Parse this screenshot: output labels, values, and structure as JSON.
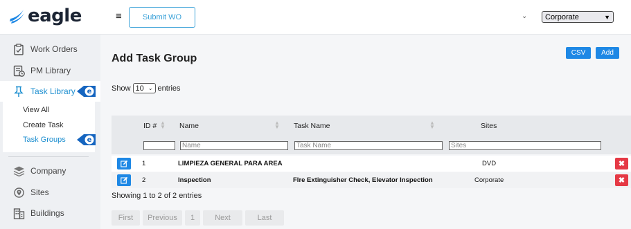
{
  "header": {
    "logo_text": "eagle",
    "menu_icon": "hamburger-icon",
    "submit_wo_label": "Submit WO",
    "site_selector_value": "Corporate",
    "brand_color": "#1e88e5"
  },
  "sidebar": {
    "items": [
      {
        "label": "Work Orders",
        "icon": "clipboard-check-icon"
      },
      {
        "label": "PM Library",
        "icon": "document-clock-icon"
      },
      {
        "label": "Task Library",
        "icon": "pin-icon",
        "active": true
      },
      {
        "label": "Company",
        "icon": "layers-icon"
      },
      {
        "label": "Sites",
        "icon": "location-target-icon"
      },
      {
        "label": "Buildings",
        "icon": "building-icon"
      }
    ],
    "subitems": [
      {
        "label": "View All"
      },
      {
        "label": "Create Task"
      },
      {
        "label": "Task Groups",
        "active": true
      }
    ]
  },
  "main": {
    "title": "Add Task Group",
    "csv_label": "CSV",
    "add_label": "Add",
    "show_label": "Show",
    "entries_label": "entries",
    "page_length": "10",
    "columns": [
      "ID #",
      "Name",
      "Task Name",
      "Sites"
    ],
    "filters": {
      "id": "",
      "name": "Name",
      "task_name": "Task Name",
      "sites": "Sites"
    },
    "rows": [
      {
        "id": "1",
        "name": "LIMPIEZA GENERAL PARA AREA",
        "task_name": "",
        "sites": "DVD"
      },
      {
        "id": "2",
        "name": "Inspection",
        "task_name": "FIre Extinguisher Check, Elevator Inspection",
        "sites": "Corporate"
      }
    ],
    "info": "Showing 1 to 2 of 2 entries",
    "pagination": {
      "first": "First",
      "previous": "Previous",
      "page": "1",
      "next": "Next",
      "last": "Last"
    },
    "colors": {
      "edit": "#1e88e5",
      "delete": "#e53945"
    }
  }
}
